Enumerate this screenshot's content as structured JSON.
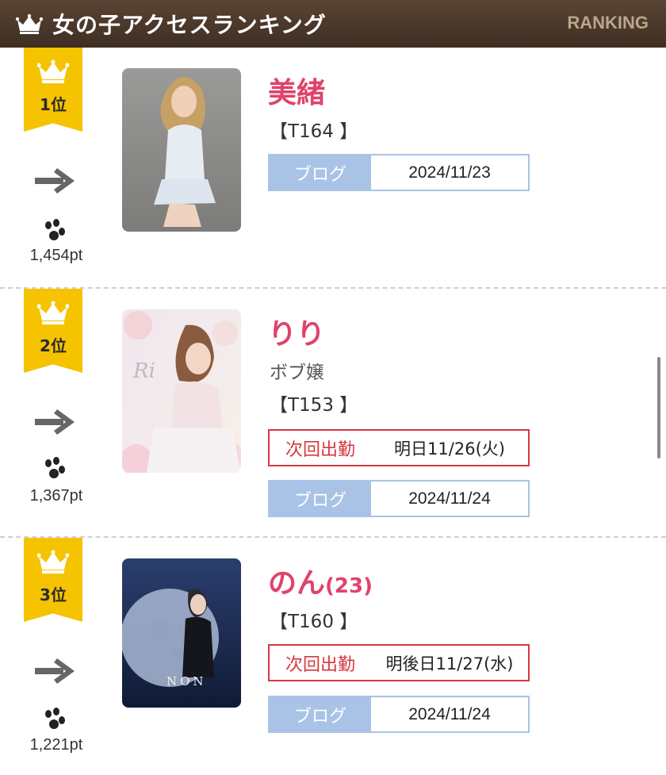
{
  "header": {
    "title": "女の子アクセスランキング",
    "subtitle": "RANKING"
  },
  "entries": [
    {
      "rank": "1位",
      "name": "美緒",
      "age": "",
      "tag": "",
      "height": "【T164 】",
      "next_label": "",
      "next_value": "",
      "blog_label": "ブログ",
      "blog_date": "2024/11/23",
      "points": "1,454pt"
    },
    {
      "rank": "2位",
      "name": "りり",
      "age": "",
      "tag": "ボブ嬢",
      "height": "【T153 】",
      "next_label": "次回出勤",
      "next_value": "明日11/26(火)",
      "blog_label": "ブログ",
      "blog_date": "2024/11/24",
      "points": "1,367pt"
    },
    {
      "rank": "3位",
      "name": "のん",
      "age": "(23)",
      "tag": "",
      "height": "【T160 】",
      "next_label": "次回出勤",
      "next_value": "明後日11/27(水)",
      "blog_label": "ブログ",
      "blog_date": "2024/11/24",
      "points": "1,221pt"
    }
  ],
  "colors": {
    "header_bg": "#3e2e22",
    "accent_pink": "#e0436a",
    "badge_yellow": "#f6c300",
    "blog_blue": "#a9c3e6",
    "shift_red": "#d8373f"
  },
  "icons": {
    "header": "crown-icon",
    "trend": "arrow-right-icon",
    "points": "paw-icon"
  }
}
